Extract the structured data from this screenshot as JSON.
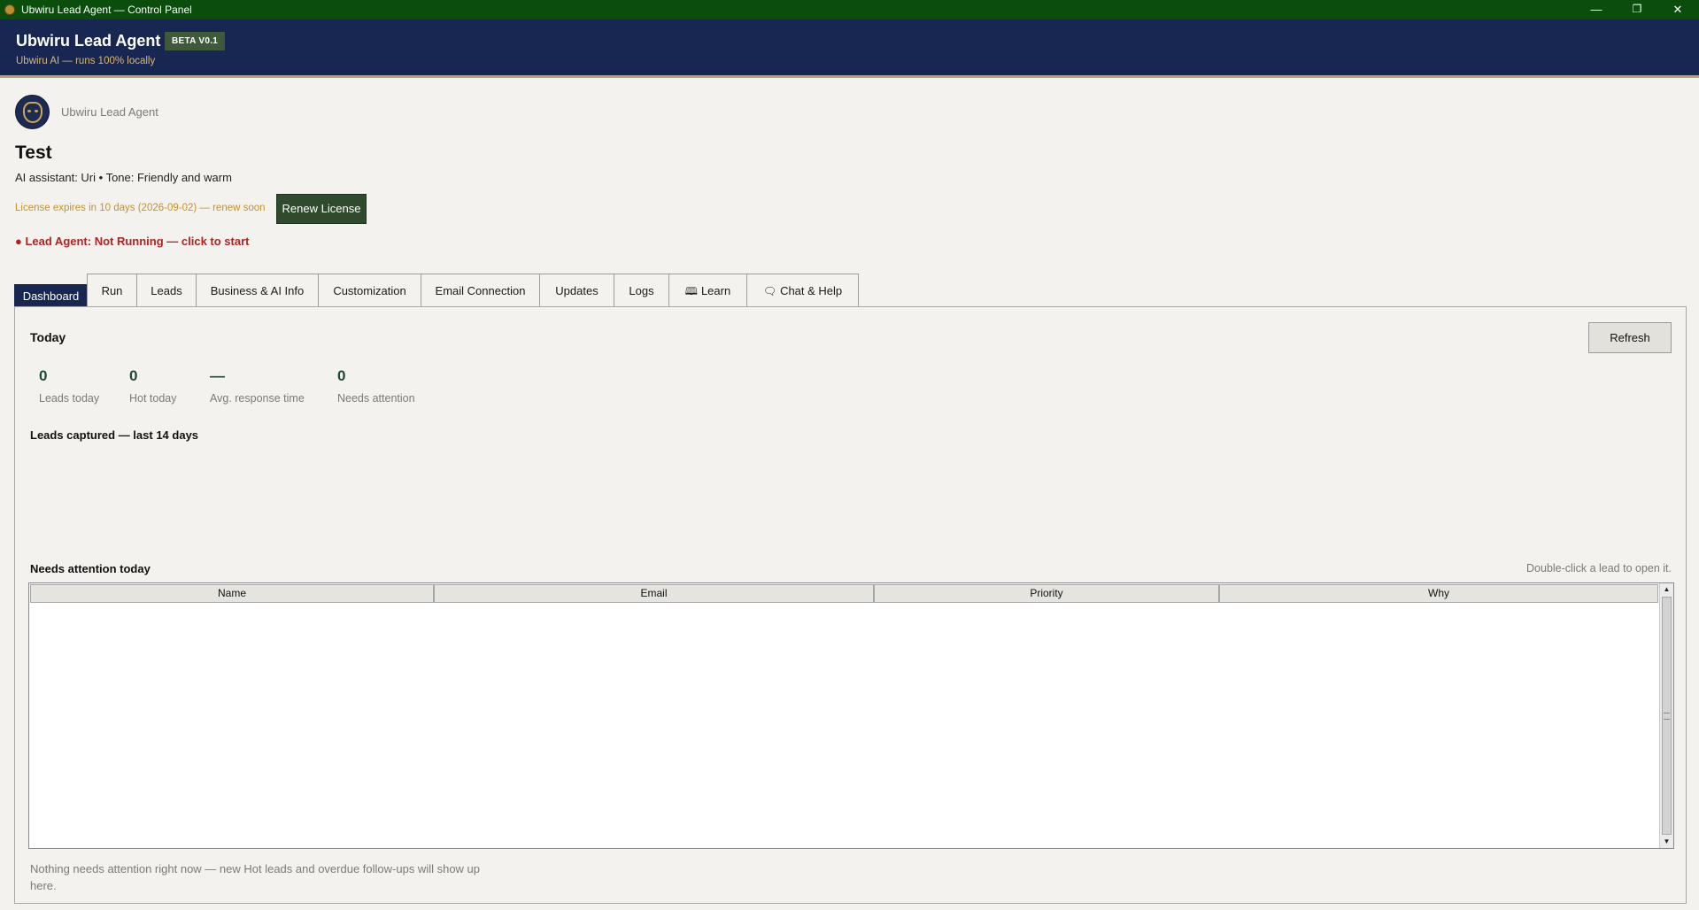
{
  "window": {
    "title": "Ubwiru Lead Agent — Control Panel",
    "controls": {
      "minimize": "—",
      "restore": "❐",
      "close": "✕"
    }
  },
  "header": {
    "app_title": "Ubwiru Lead Agent",
    "badge": "BETA V0.1",
    "subtitle": "Ubwiru AI — runs 100% locally"
  },
  "brand": {
    "logo_icon": "lion-mask-icon",
    "label": "Ubwiru Lead Agent"
  },
  "client": {
    "name": "Test",
    "assistant_line": "AI assistant: Uri  •  Tone: Friendly and warm"
  },
  "license": {
    "text": "License expires in 10 days (2026-09-02) — renew soon",
    "renew_label": "Renew License"
  },
  "status": {
    "text": "●  Lead Agent: Not Running — click to start",
    "color": "#b12222"
  },
  "tabs": [
    {
      "label": "Dashboard",
      "active": true
    },
    {
      "label": "Run"
    },
    {
      "label": "Leads"
    },
    {
      "label": "Business & AI Info"
    },
    {
      "label": "Customization"
    },
    {
      "label": "Email Connection"
    },
    {
      "label": "Updates"
    },
    {
      "label": "Logs"
    },
    {
      "label": "Learn",
      "icon": "learn-icon"
    },
    {
      "label": "Chat & Help",
      "icon": "chat-bubble-icon"
    }
  ],
  "dashboard": {
    "today_title": "Today",
    "refresh_label": "Refresh",
    "kpis": [
      {
        "value": "0",
        "label": "Leads today"
      },
      {
        "value": "0",
        "label": "Hot today"
      },
      {
        "value": "—",
        "label": "Avg. response time"
      },
      {
        "value": "0",
        "label": "Needs attention"
      }
    ],
    "chart_title": "Leads captured — last 14 days",
    "attention_title": "Needs attention today",
    "attention_hint": "Double-click a lead to open it.",
    "table": {
      "columns": [
        "Name",
        "Email",
        "Priority",
        "Why"
      ],
      "rows": []
    },
    "empty_message": "Nothing needs attention right now — new Hot leads and overdue follow-ups will show up here."
  },
  "colors": {
    "titlebar": "#0b4d0d",
    "header": "#172751",
    "accent_gold": "#c6a05a",
    "renew_button": "#2f4a2d",
    "kpi_value": "#1f4a35"
  }
}
